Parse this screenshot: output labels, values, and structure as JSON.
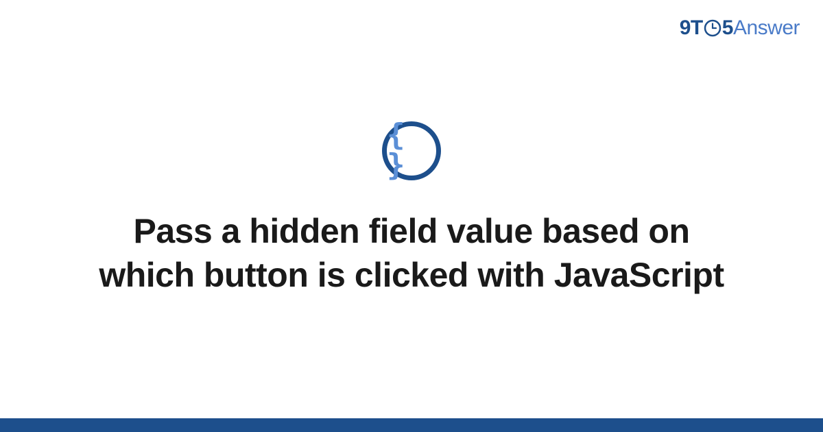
{
  "logo": {
    "part1": "9T",
    "part2": "5",
    "part3": "Answer"
  },
  "icon": {
    "braces": "{ }",
    "name": "code-braces-icon"
  },
  "title": "Pass a hidden field value based on which button is clicked with JavaScript",
  "colors": {
    "primary": "#1d4f8c",
    "secondary": "#4a7bc8",
    "braces": "#5b8fd6"
  }
}
